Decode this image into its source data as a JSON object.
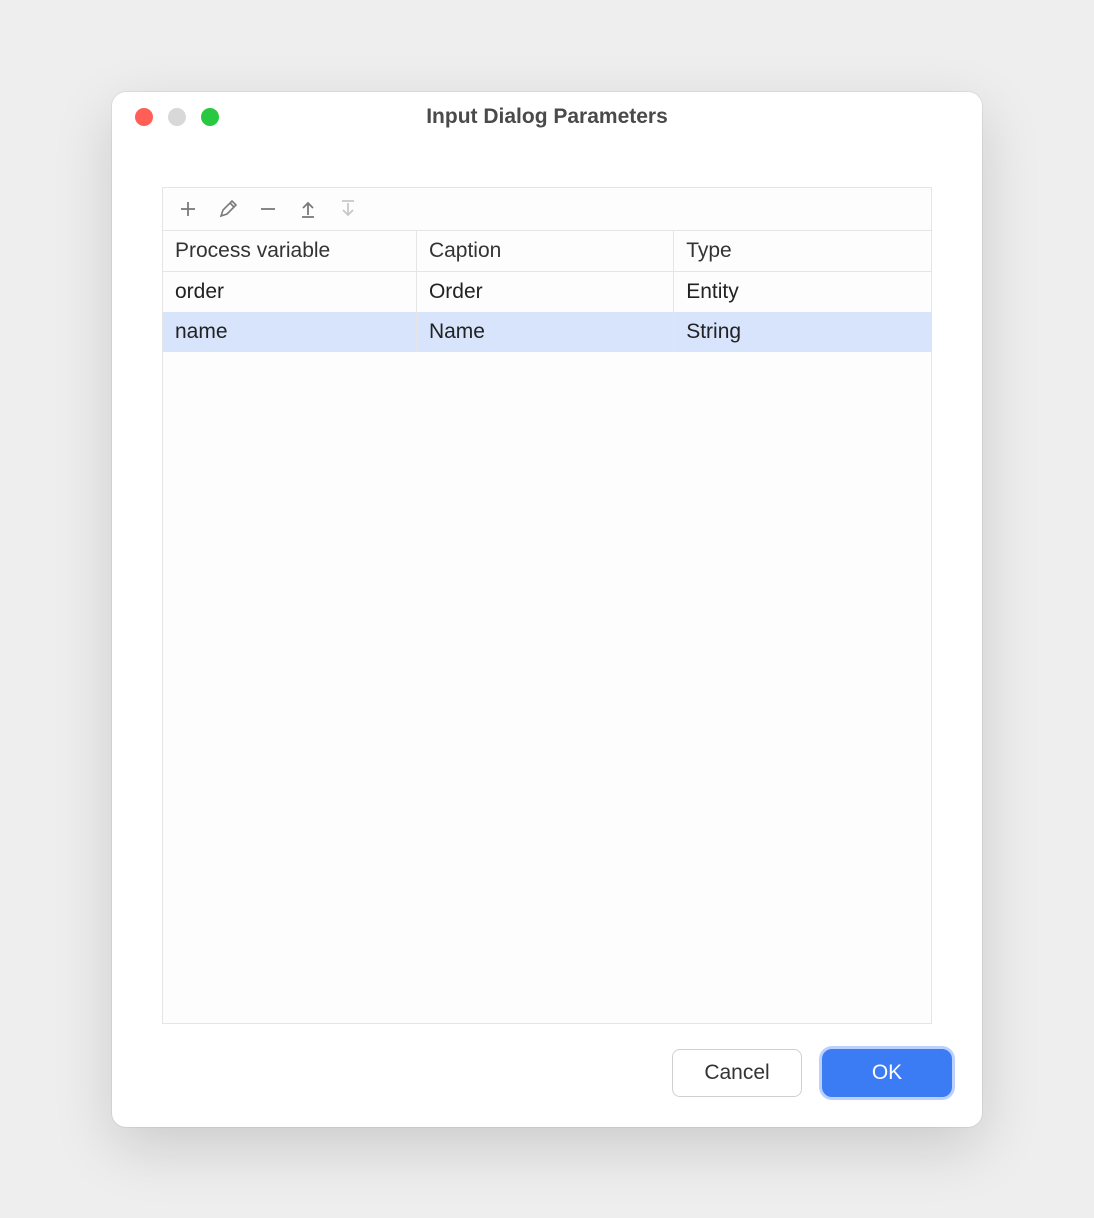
{
  "window": {
    "title": "Input Dialog Parameters"
  },
  "toolbar": {
    "icons": {
      "add": "plus-icon",
      "edit": "pencil-icon",
      "remove": "minus-icon",
      "up": "arrow-up-icon",
      "down": "arrow-down-icon"
    }
  },
  "table": {
    "headers": {
      "process_variable": "Process variable",
      "caption": "Caption",
      "type": "Type"
    },
    "rows": [
      {
        "process_variable": "order",
        "caption": "Order",
        "type": "Entity",
        "selected": false
      },
      {
        "process_variable": "name",
        "caption": "Name",
        "type": "String",
        "selected": true
      }
    ]
  },
  "footer": {
    "cancel_label": "Cancel",
    "ok_label": "OK"
  }
}
